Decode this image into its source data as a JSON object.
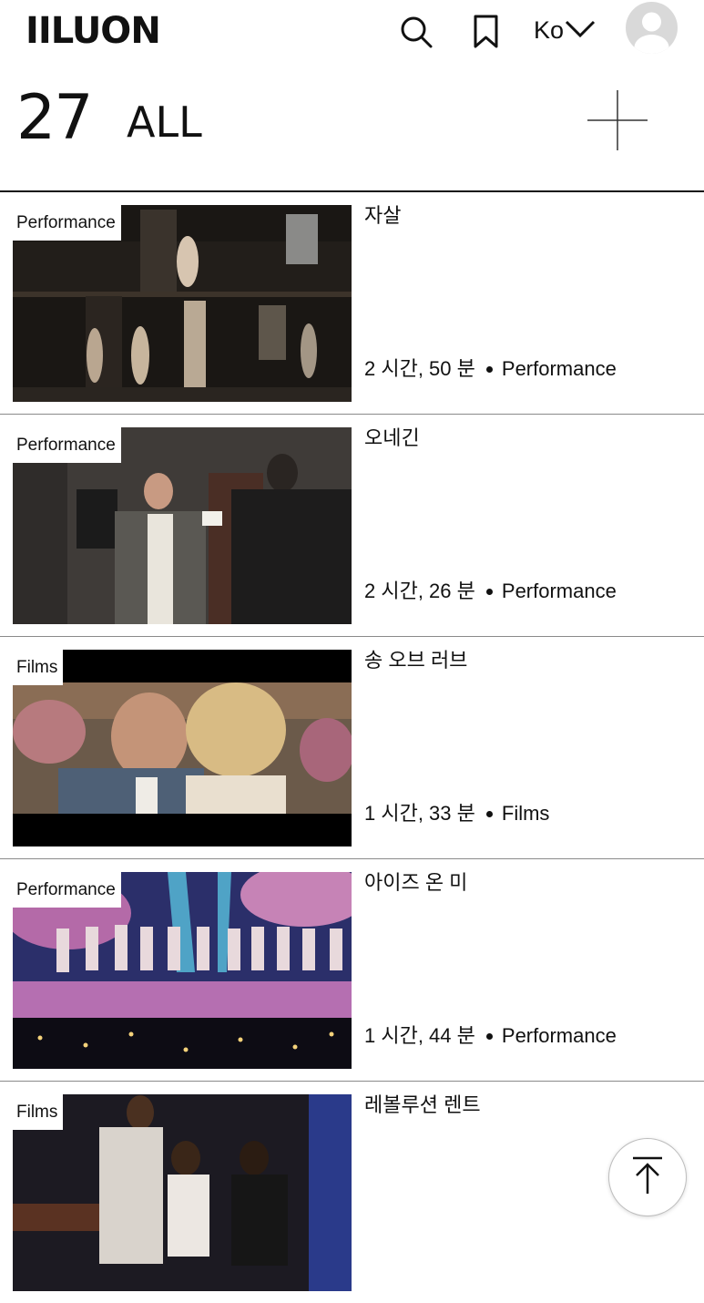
{
  "header": {
    "logo": "IILUON",
    "language": "Ko",
    "icons": {
      "search": "search-icon",
      "bookmark": "bookmark-icon",
      "language_toggle": "chevron-down-icon",
      "avatar": "user-avatar-icon"
    }
  },
  "summary": {
    "count": "27",
    "filter_label": "ALL",
    "add_icon": "plus-icon"
  },
  "items": [
    {
      "badge": "Performance",
      "title": "자살",
      "duration": "2 시간, 50 분",
      "category": "Performance"
    },
    {
      "badge": "Performance",
      "title": "오네긴",
      "duration": "2 시간, 26 분",
      "category": "Performance"
    },
    {
      "badge": "Films",
      "title": "송 오브 러브",
      "duration": "1 시간, 33 분",
      "category": "Films"
    },
    {
      "badge": "Performance",
      "title": "아이즈 온 미",
      "duration": "1 시간, 44 분",
      "category": "Performance"
    },
    {
      "badge": "Films",
      "title": "레볼루션 렌트",
      "duration": "",
      "category": ""
    }
  ],
  "scroll_top": {
    "icon": "arrow-up-icon"
  },
  "colors": {
    "text": "#111111",
    "background": "#ffffff",
    "divider": "#8a8a8a"
  }
}
